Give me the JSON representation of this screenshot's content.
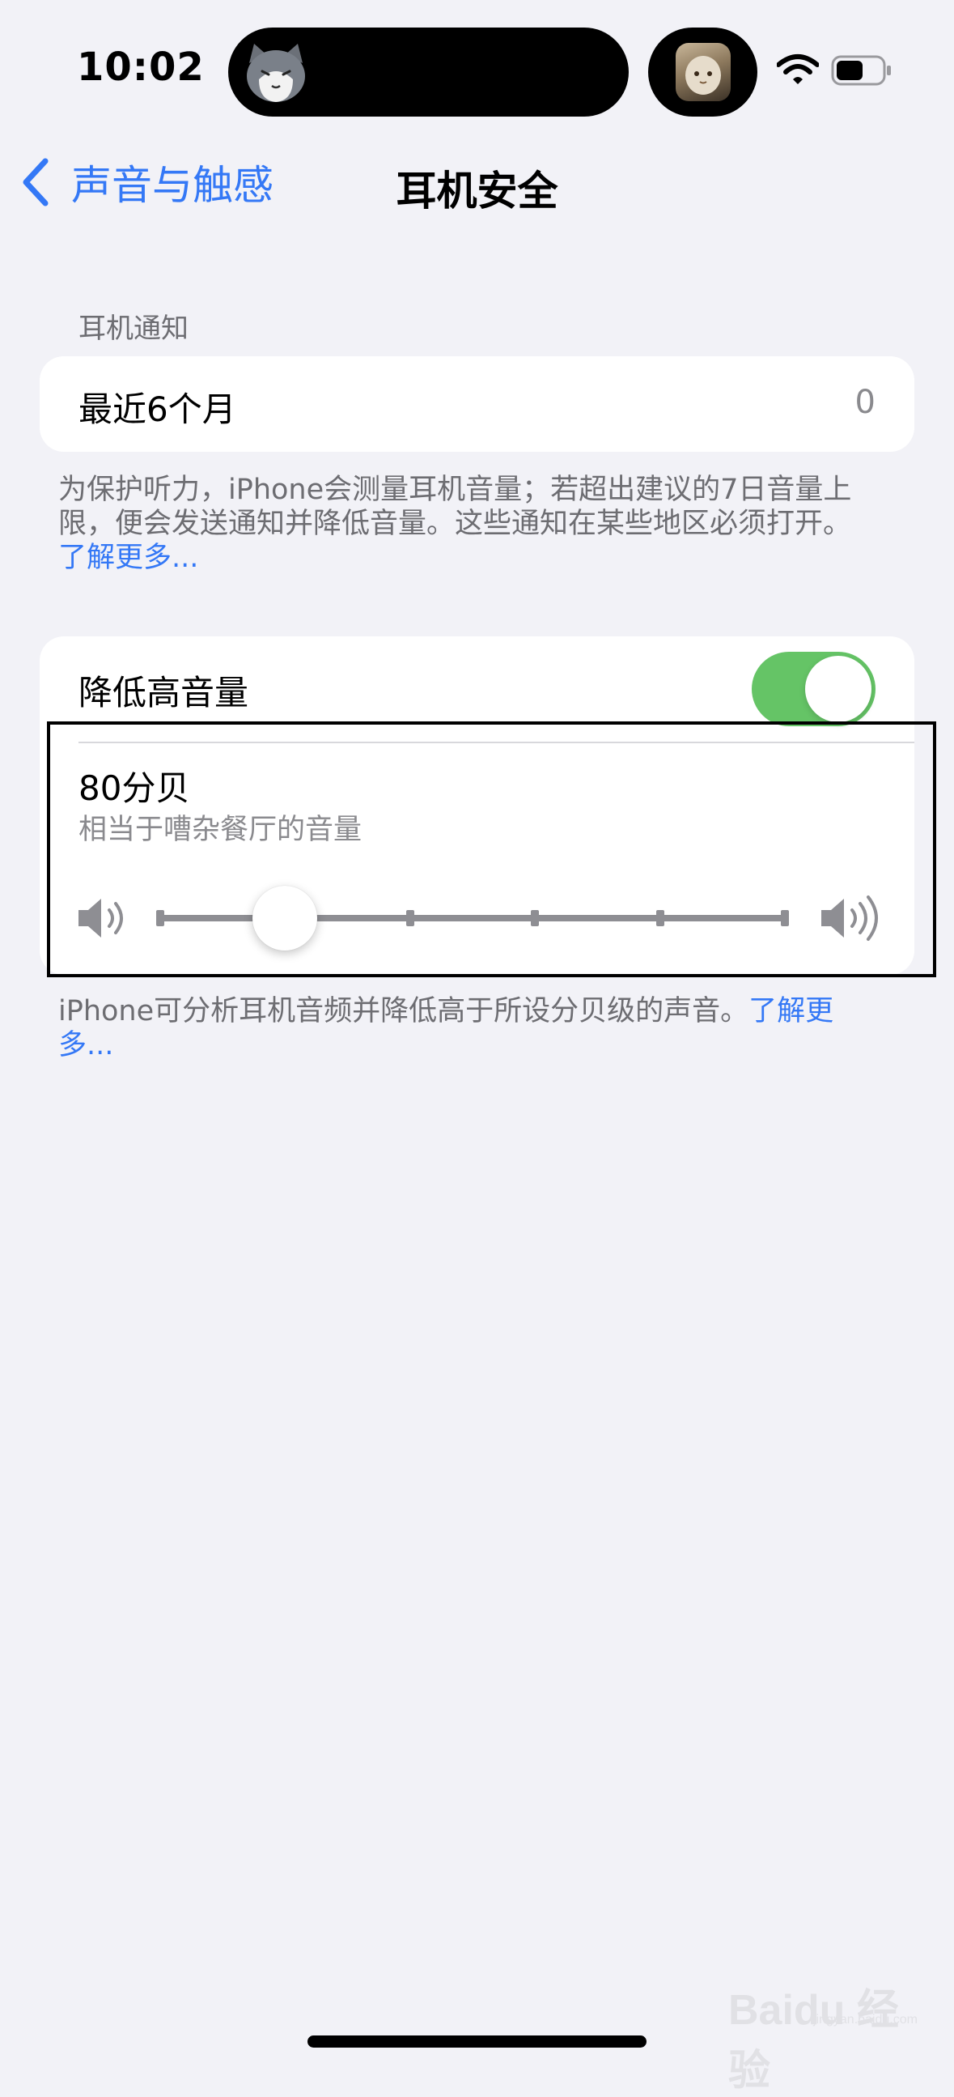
{
  "status_bar": {
    "time": "10:02"
  },
  "nav": {
    "back_label": "声音与触感",
    "title": "耳机安全"
  },
  "notifications_section": {
    "header": "耳机通知",
    "row_label": "最近6个月",
    "row_value": "0",
    "footer_line1": "为保护听力，iPhone会测量耳机音量；若超出建议的7日音量上",
    "footer_line2": "限，便会发送通知并降低音量。这些通知在某些地区必须打开。",
    "footer_link": "了解更多..."
  },
  "reduce_section": {
    "toggle_label": "降低高音量",
    "toggle_on": true,
    "level_value": "80分贝",
    "level_desc": "相当于嘈杂餐厅的音量",
    "slider_level_fraction": 0.2,
    "slider_step_count": 5,
    "footer_text": "iPhone可分析耳机音频并降低高于所设分贝级的声音。",
    "footer_link_part1": "了解更",
    "footer_link_part2": "多..."
  },
  "watermark": {
    "text": "Baidu 经验",
    "sub": "jingyan.baidu.com"
  },
  "colors": {
    "accent": "#3478f6",
    "toggle_on": "#65c466",
    "background": "#f2f2f7"
  }
}
